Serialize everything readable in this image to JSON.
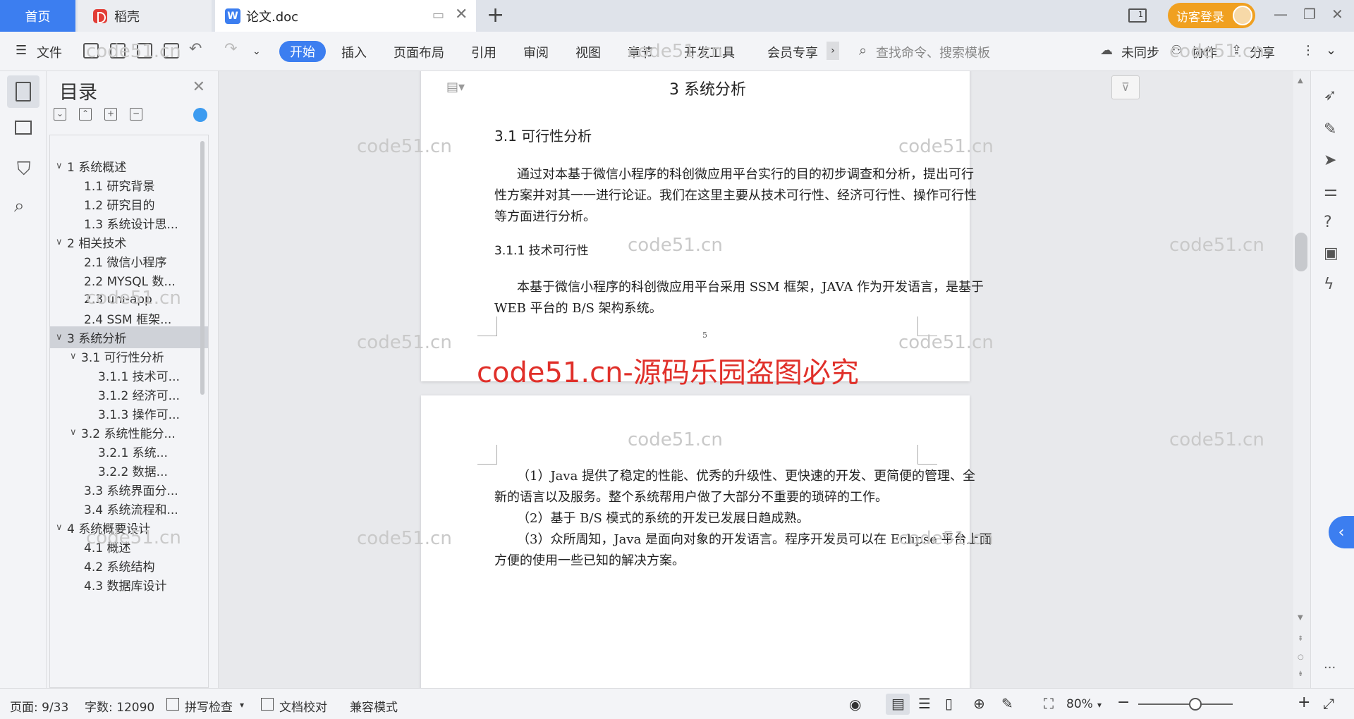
{
  "tabs": {
    "home": "首页",
    "daoke": "稻壳",
    "doc": "论文.doc"
  },
  "window": {
    "login": "访客登录"
  },
  "toolbar": {
    "file": "文件",
    "menus": [
      "开始",
      "插入",
      "页面布局",
      "引用",
      "审阅",
      "视图",
      "章节",
      "开发工具",
      "会员专享"
    ],
    "search_placeholder": "查找命令、搜索模板",
    "sync": "未同步",
    "collab": "协作",
    "share": "分享"
  },
  "toc": {
    "title": "目录",
    "items": [
      {
        "level": 1,
        "label": "1 系统概述",
        "expanded": true
      },
      {
        "level": 2,
        "label": "1.1  研究背景"
      },
      {
        "level": 2,
        "label": "1.2 研究目的"
      },
      {
        "level": 2,
        "label": "1.3 系统设计思..."
      },
      {
        "level": 1,
        "label": "2 相关技术",
        "expanded": true
      },
      {
        "level": 2,
        "label": "2.1 微信小程序"
      },
      {
        "level": 2,
        "label": "2.2 MYSQL 数..."
      },
      {
        "level": 2,
        "label": "2.3 uni-app"
      },
      {
        "level": 2,
        "label": "2.4 SSM 框架..."
      },
      {
        "level": 1,
        "label": "3 系统分析",
        "expanded": true,
        "selected": true
      },
      {
        "level": 2,
        "label": "3.1 可行性分析",
        "expanded": true
      },
      {
        "level": 3,
        "label": "3.1.1 技术可..."
      },
      {
        "level": 3,
        "label": "3.1.2 经济可..."
      },
      {
        "level": 3,
        "label": "3.1.3 操作可..."
      },
      {
        "level": 2,
        "label": "3.2 系统性能分...",
        "expanded": true
      },
      {
        "level": 3,
        "label": "3.2.1  系统..."
      },
      {
        "level": 3,
        "label": "3.2.2  数据..."
      },
      {
        "level": 2,
        "label": "3.3 系统界面分..."
      },
      {
        "level": 2,
        "label": "3.4 系统流程和..."
      },
      {
        "level": 1,
        "label": "4 系统概要设计",
        "expanded": true
      },
      {
        "level": 2,
        "label": "4.1 概述"
      },
      {
        "level": 2,
        "label": "4.2 系统结构"
      },
      {
        "level": 2,
        "label": "4.3 数据库设计"
      }
    ]
  },
  "document": {
    "page1": {
      "chapter": "3 系统分析",
      "section": "3.1 可行性分析",
      "para1": [
        "通过对本基于微信小程序的科创微应用平台实行的目的初步调查和分析，提出可行",
        "性方案并对其一一进行论证。我们在这里主要从技术可行性、经济可行性、操作可行性",
        "等方面进行分析。"
      ],
      "subsection": "3.1.1 技术可行性",
      "para2": [
        "本基于微信小程序的科创微应用平台采用 SSM 框架，JAVA 作为开发语言，是基于",
        "WEB 平台的 B/S 架构系统。"
      ],
      "page_number": "5"
    },
    "page2": {
      "lines": [
        "（1）Java 提供了稳定的性能、优秀的升级性、更快速的开发、更简便的管理、全",
        "新的语言以及服务。整个系统帮用户做了大部分不重要的琐碎的工作。",
        "（2）基于 B/S 模式的系统的开发已发展日趋成熟。",
        "（3）众所周知，Java 是面向对象的开发语言。程序开发员可以在 Eclipse 平台上面",
        "方便的使用一些已知的解决方案。"
      ]
    }
  },
  "watermarks": {
    "small": "code51.cn",
    "big": "code51.cn-源码乐园盗图必究"
  },
  "status": {
    "page": "页面: 9/33",
    "words": "字数: 12090",
    "spell": "拼写检查",
    "proof": "文档校对",
    "compat": "兼容模式",
    "zoom": "80%"
  }
}
